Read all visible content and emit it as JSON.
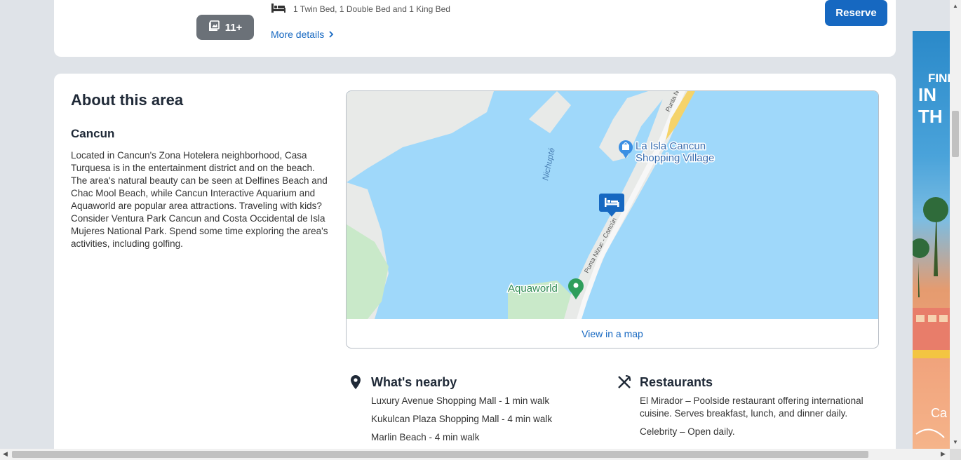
{
  "room": {
    "photos_count": "11+",
    "beds": "1 Twin Bed, 1 Double Bed and 1 King Bed",
    "more_details": "More details",
    "reserve": "Reserve"
  },
  "about": {
    "title": "About this area",
    "city": "Cancun",
    "description": "Located in Cancun's Zona Hotelera neighborhood, Casa Turquesa is in the entertainment district and on the beach. The area's natural beauty can be seen at Delfines Beach and Chac Mool Beach, while Cancun Interactive Aquarium and Aquaworld are popular area attractions. Traveling with kids? Consider Ventura Park Cancun and Costa Occidental de Isla Mujeres National Park. Spend some time exploring the area's activities, including golfing."
  },
  "map": {
    "labels": {
      "lagoon": "Nichupté",
      "mall": "La Isla Cancun Shopping Village",
      "mall_line1": "La Isla Cancun",
      "mall_line2": "Shopping Village",
      "aquaworld": "Aquaworld",
      "road1": "Punta Nizuc - Cancún",
      "road2": "Punta N"
    },
    "link": "View in a map",
    "colors": {
      "water": "#9fd8fa",
      "land": "#e8eae8",
      "road": "#f7f7f7",
      "marker": "#1668c1",
      "green_marker": "#2e9e5b"
    }
  },
  "nearby": {
    "title": "What's nearby",
    "items": [
      "Luxury Avenue Shopping Mall - 1 min walk",
      "Kukulcan Plaza Shopping Mall - 4 min walk",
      "Marlin Beach - 4 min walk"
    ]
  },
  "restaurants": {
    "title": "Restaurants",
    "items": [
      "El Mirador – Poolside restaurant offering international cuisine. Serves breakfast, lunch, and dinner daily.",
      "Celebrity – Open daily."
    ]
  },
  "ad": {
    "line1": "FIND",
    "line2": "IN TH",
    "line3": "Ca"
  }
}
